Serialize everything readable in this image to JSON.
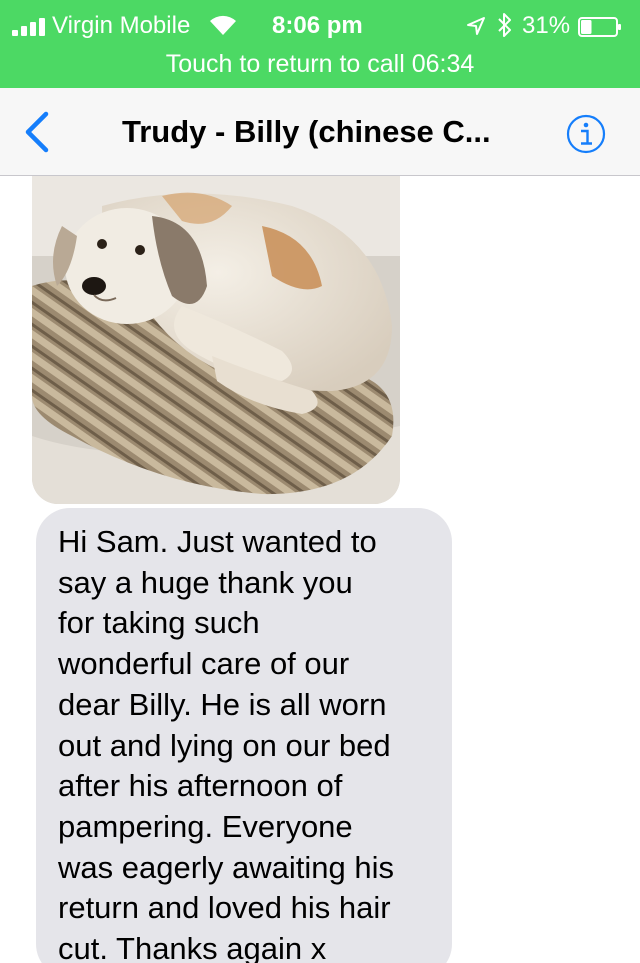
{
  "status_bar": {
    "carrier": "Virgin Mobile",
    "time": "8:06 pm",
    "battery_percent": "31%",
    "battery_level": 0.31,
    "icons": [
      "signal-icon",
      "wifi-icon",
      "location-arrow-icon",
      "bluetooth-icon",
      "battery-icon"
    ],
    "call_banner": "Touch to return to call 06:34",
    "background_color": "#4cd964"
  },
  "nav": {
    "title": "Trudy - Billy (chinese C...",
    "back_icon": "chevron-left-icon",
    "info_icon": "info-icon",
    "accent_color": "#157efb"
  },
  "conversation": {
    "messages": [
      {
        "type": "image",
        "description_icon": "photo-attachment"
      },
      {
        "type": "text",
        "text": "Hi Sam. Just wanted to\nsay a huge thank you\nfor taking such\nwonderful care of our\ndear Billy. He is all worn\nout and lying on our bed\nafter his afternoon of\npampering. Everyone\nwas eagerly awaiting his\nreturn and loved his hair\ncut. Thanks again x"
      }
    ],
    "bubble_color": "#e5e5ea"
  }
}
